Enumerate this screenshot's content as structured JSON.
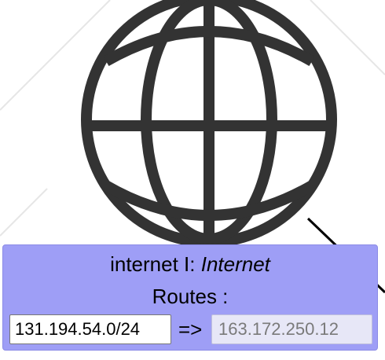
{
  "node": {
    "label": "internet I: ",
    "type": "Internet",
    "icon": "globe-icon"
  },
  "routes": {
    "heading": "Routes :",
    "entries": [
      {
        "network": "131.194.54.0/24",
        "arrow": "=>",
        "gateway": "163.172.250.12"
      }
    ]
  },
  "colors": {
    "panel": "#9e9ef6",
    "globe": "#333333",
    "link": "#000000"
  }
}
